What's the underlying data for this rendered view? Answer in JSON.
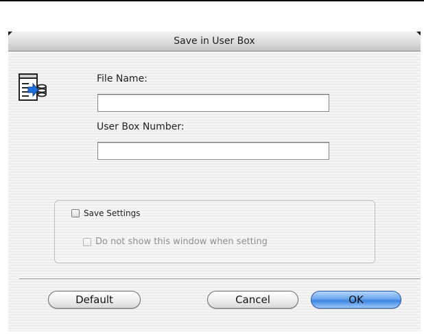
{
  "dialog": {
    "title": "Save in User Box",
    "icon": "save-to-box-icon"
  },
  "fields": {
    "file_name_label": "File Name:",
    "file_name_value": "",
    "user_box_label": "User Box Number:",
    "user_box_value": ""
  },
  "options": {
    "save_settings_label": "Save Settings",
    "save_settings_checked": false,
    "dont_show_label": "Do not show this window when setting",
    "dont_show_checked": false,
    "dont_show_enabled": false
  },
  "buttons": {
    "default_label": "Default",
    "cancel_label": "Cancel",
    "ok_label": "OK"
  },
  "colors": {
    "primary_button": "#4a8fe3",
    "disabled_text": "#8f8f8f"
  }
}
